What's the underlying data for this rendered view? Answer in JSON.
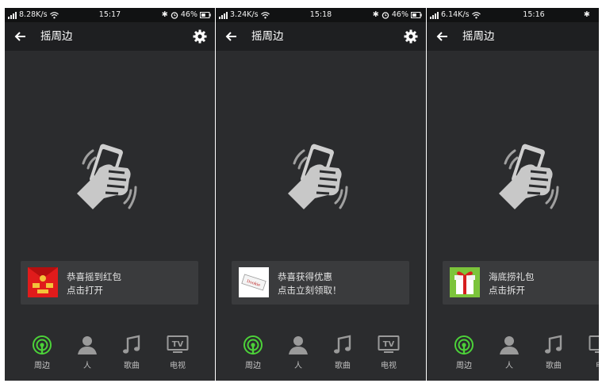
{
  "screens": [
    {
      "status": {
        "speed": "8.28K/s",
        "time": "15:17",
        "battery": "46%"
      },
      "header": {
        "title": "摇周边"
      },
      "card": {
        "line1": "恭喜摇到红包",
        "line2": "点击打开",
        "thumb": "red-envelope"
      },
      "tabs": [
        {
          "label": "周边",
          "icon": "radar-icon"
        },
        {
          "label": "人",
          "icon": "person-icon"
        },
        {
          "label": "歌曲",
          "icon": "music-icon"
        },
        {
          "label": "电视",
          "icon": "tv-icon"
        }
      ]
    },
    {
      "status": {
        "speed": "3.24K/s",
        "time": "15:18",
        "battery": "46%"
      },
      "header": {
        "title": "摇周边"
      },
      "card": {
        "line1": "恭喜获得优惠",
        "line2": "点击立刻领取！",
        "thumb": "coupon-ticket",
        "thumb_text": "Dookie"
      },
      "tabs": [
        {
          "label": "周边",
          "icon": "radar-icon"
        },
        {
          "label": "人",
          "icon": "person-icon"
        },
        {
          "label": "歌曲",
          "icon": "music-icon"
        },
        {
          "label": "电视",
          "icon": "tv-icon"
        }
      ]
    },
    {
      "status": {
        "speed": "6.14K/s",
        "time": "15:16"
      },
      "header": {
        "title": "摇周边"
      },
      "card": {
        "line1": "海底捞礼包",
        "line2": "点击拆开",
        "thumb": "gift-box"
      },
      "tabs": [
        {
          "label": "周边",
          "icon": "radar-icon"
        },
        {
          "label": "人",
          "icon": "person-icon"
        },
        {
          "label": "歌曲",
          "icon": "music-icon"
        },
        {
          "label": "电",
          "icon": "tv-icon"
        }
      ]
    }
  ],
  "colors": {
    "background": "#2b2c2e",
    "titlebar": "#1e1f21",
    "statusbar": "#111213",
    "accent": "#4cd239",
    "card": "#3a3b3d",
    "icon_inactive": "#9a9a9a"
  }
}
